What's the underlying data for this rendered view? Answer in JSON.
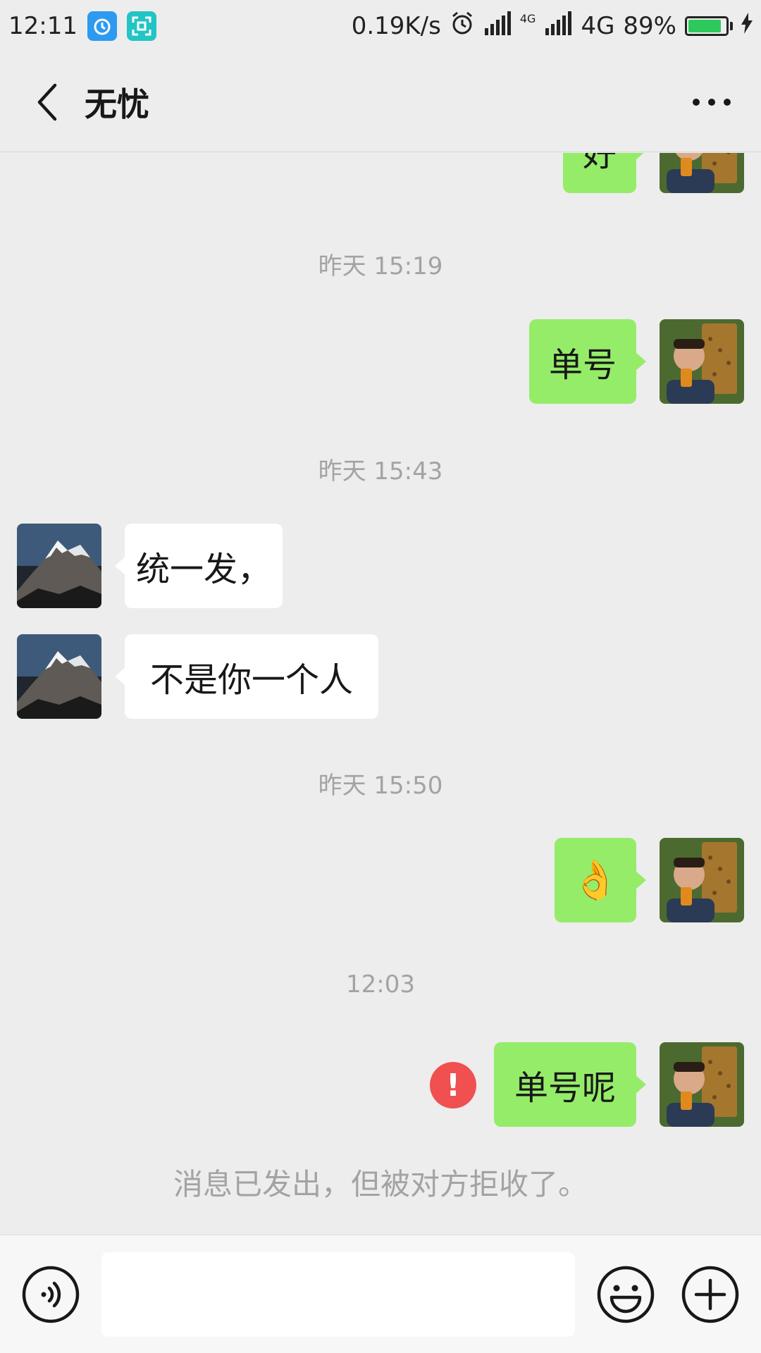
{
  "status_bar": {
    "time": "12:11",
    "network_speed": "0.19K/s",
    "network_type": "4G",
    "network_type_small": "4G",
    "battery_percent": "89%",
    "battery_level": 0.89,
    "icons": [
      "alarm-app-icon",
      "scanner-app-icon",
      "alarm-clock-icon",
      "signal-icon",
      "signal-icon",
      "battery-icon",
      "charging-icon"
    ]
  },
  "header": {
    "title": "无忧",
    "back_icon": "chevron-left-icon",
    "more_icon": "more-dots-icon"
  },
  "messages": [
    {
      "type": "sent",
      "text": "好"
    },
    {
      "type": "time",
      "text": "昨天 15:19"
    },
    {
      "type": "sent",
      "text": "单号"
    },
    {
      "type": "time",
      "text": "昨天 15:43"
    },
    {
      "type": "received",
      "text": "统一发，"
    },
    {
      "type": "received",
      "text": "不是你一个人"
    },
    {
      "type": "time",
      "text": "昨天 15:50"
    },
    {
      "type": "sent",
      "text": "👌",
      "emoji": "ok-hand-emoji"
    },
    {
      "type": "time",
      "text": "12:03"
    },
    {
      "type": "sent",
      "text": "单号呢",
      "failed": true
    },
    {
      "type": "notice",
      "text": "消息已发出，但被对方拒收了。"
    }
  ],
  "input_bar": {
    "value": "",
    "voice_icon": "voice-icon",
    "emoji_icon": "emoji-icon",
    "plus_icon": "plus-icon"
  },
  "colors": {
    "background": "#ededed",
    "sent_bubble": "#95ec69",
    "received_bubble": "#ffffff",
    "error": "#f05050",
    "timestamp_text": "#a3a3a3"
  }
}
